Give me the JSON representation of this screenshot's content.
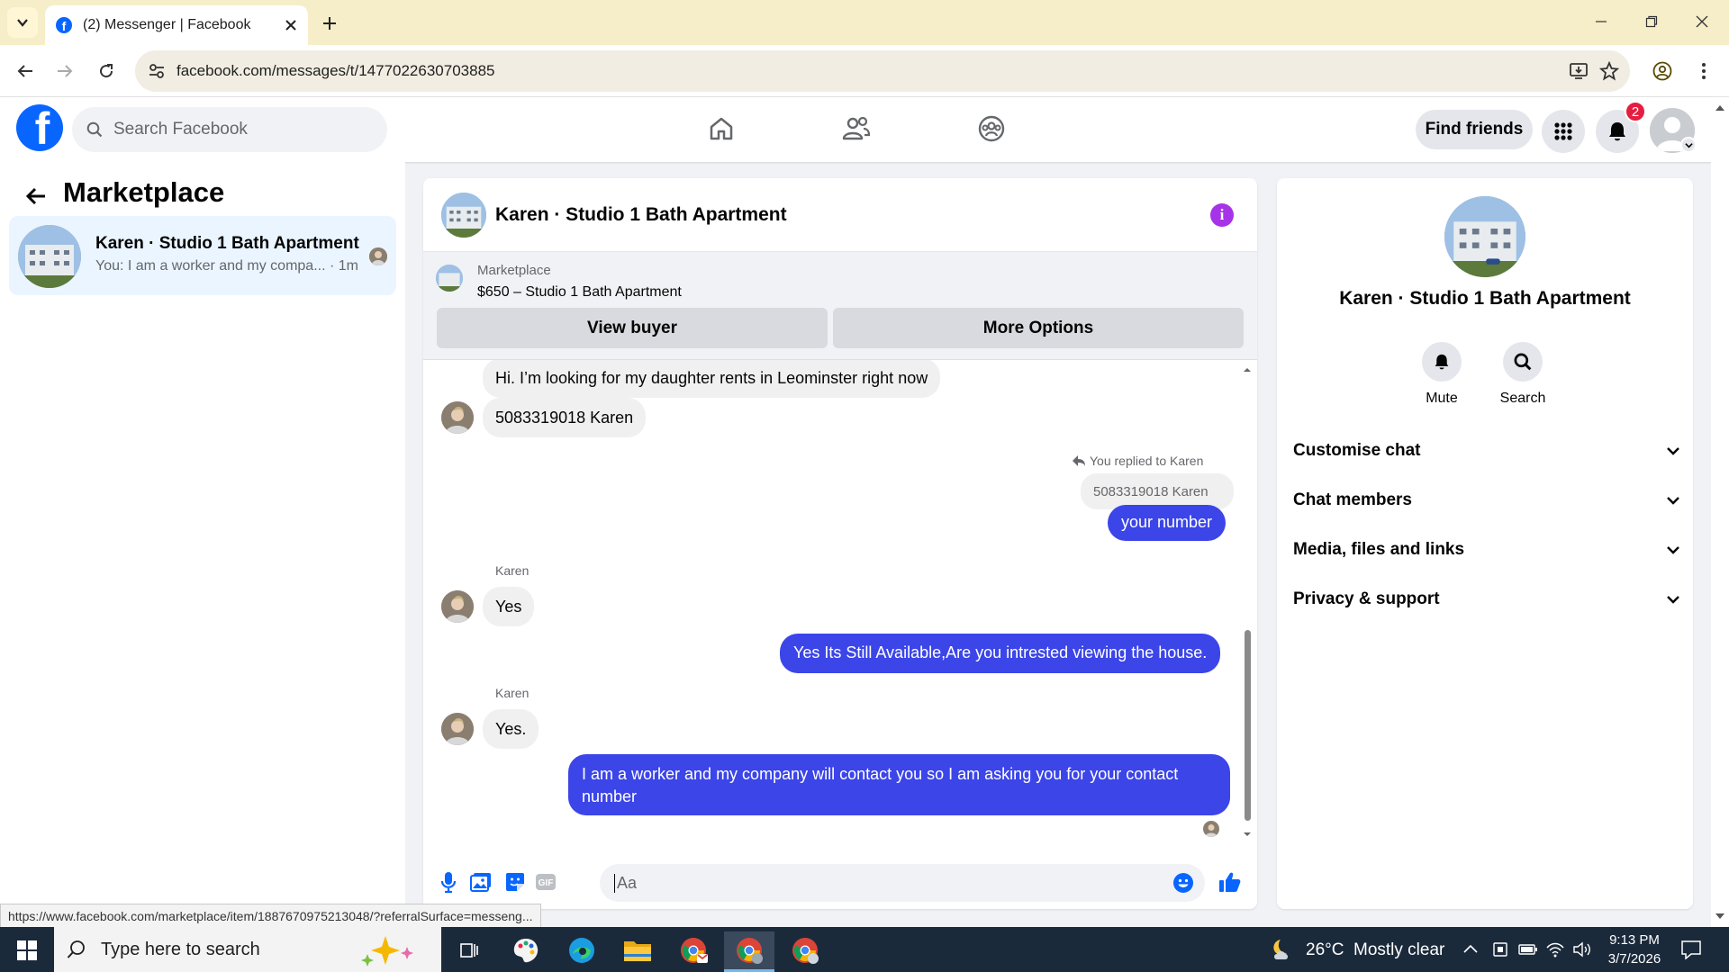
{
  "browser": {
    "tab_title": "(2) Messenger | Facebook",
    "url": "facebook.com/messages/t/1477022630703885",
    "status_url": "https://www.facebook.com/marketplace/item/1887670975213048/?referralSurface=messeng..."
  },
  "fb_header": {
    "search_placeholder": "Search Facebook",
    "find_friends": "Find friends",
    "notification_count": "2"
  },
  "left_panel": {
    "title": "Marketplace",
    "conversation": {
      "name": "Karen · Studio 1 Bath Apartment",
      "preview": "You: I am a worker and my compa...",
      "time": "· 1m"
    }
  },
  "chat": {
    "title": "Karen · Studio 1 Bath Apartment",
    "listing_label": "Marketplace",
    "listing_price": "$650 – Studio 1 Bath Apartment",
    "view_buyer": "View buyer",
    "more_options": "More Options",
    "messages": {
      "m1": "Hi. I’m looking for my daughter rents in Leominster right now",
      "m2": "5083319018  Karen",
      "reply_note": "You replied to Karen",
      "quoted": "5083319018  Karen",
      "m3": "your number",
      "sender1": "Karen",
      "m4": "Yes",
      "m5": "Yes Its Still Available,Are you intrested viewing the house.",
      "sender2": "Karen",
      "m6": "Yes.",
      "m7": "I am a worker and my company will contact you so I am asking you for your contact number"
    },
    "composer_placeholder": "Aa"
  },
  "right_panel": {
    "name": "Karen · Studio 1 Bath Apartment",
    "mute": "Mute",
    "search": "Search",
    "sections": [
      "Customise chat",
      "Chat members",
      "Media, files and links",
      "Privacy & support"
    ]
  },
  "taskbar": {
    "search_placeholder": "Type here to search",
    "weather": "26°C  Mostly clear",
    "time": "9:13 PM",
    "date": "3/7/2026"
  },
  "colors": {
    "fb_blue": "#0866ff",
    "outgoing_bubble": "#3b45e8",
    "info_purple": "#a633e8",
    "tabbar": "#f6eec8"
  }
}
